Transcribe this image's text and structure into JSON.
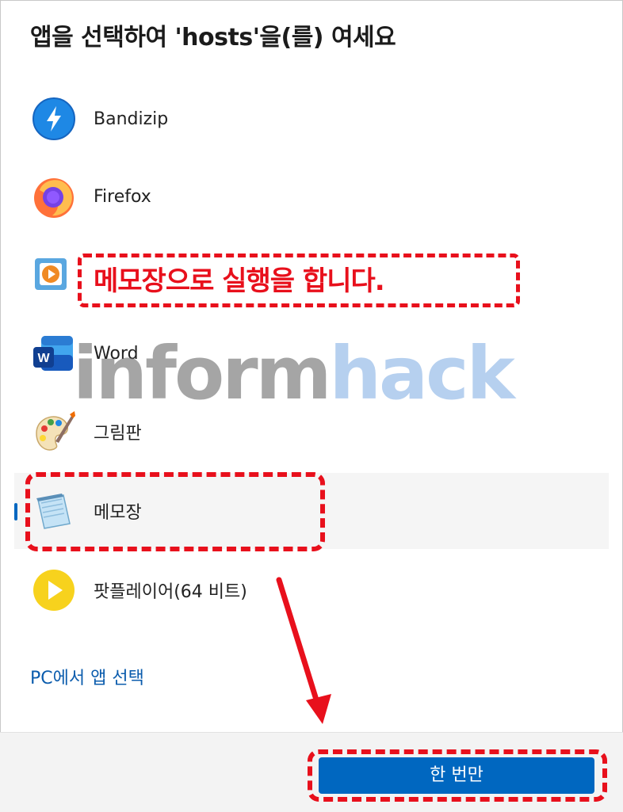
{
  "dialog": {
    "title": "앱을 선택하여 'hosts'을(를) 여세요",
    "apps": [
      {
        "label": "Bandizip",
        "icon": "bandizip-icon"
      },
      {
        "label": "Firefox",
        "icon": "firefox-icon"
      },
      {
        "label": "",
        "icon": "media-player-icon"
      },
      {
        "label": "Word",
        "icon": "word-icon"
      },
      {
        "label": "그림판",
        "icon": "paint-icon"
      },
      {
        "label": "메모장",
        "icon": "notepad-icon",
        "selected": true
      },
      {
        "label": "팟플레이어(64 비트)",
        "icon": "potplayer-icon"
      }
    ],
    "pc_link": "PC에서 앱 선택",
    "once_button": "한 번만"
  },
  "annotations": {
    "callout": "메모장으로 실행을 합니다.",
    "watermark_a": "inform",
    "watermark_b": "hack"
  },
  "colors": {
    "accent": "#0067c0",
    "annotation_red": "#e8101c"
  }
}
